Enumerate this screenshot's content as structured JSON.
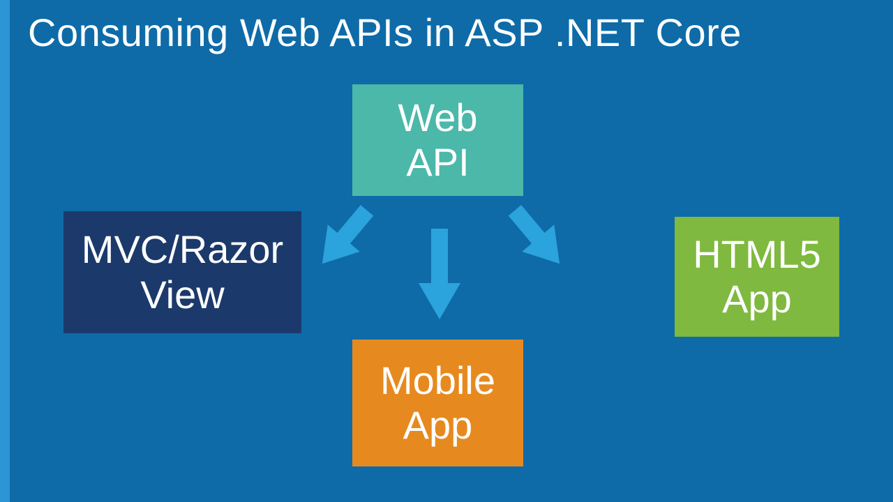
{
  "title": "Consuming Web APIs in ASP .NET Core",
  "boxes": {
    "webapi": {
      "line1": "Web",
      "line2": "API"
    },
    "mvc": {
      "line1": "MVC/Razor",
      "line2": "View"
    },
    "mobile": {
      "line1": "Mobile",
      "line2": "App"
    },
    "html5": {
      "line1": "HTML5",
      "line2": "App"
    }
  },
  "colors": {
    "background": "#0e6ba8",
    "stripe": "#2b95d6",
    "arrow": "#2ba3dc",
    "webapi": "#4bb8a9",
    "mvc": "#1b3a6b",
    "mobile": "#e68a1f",
    "html5": "#7fb93f"
  }
}
